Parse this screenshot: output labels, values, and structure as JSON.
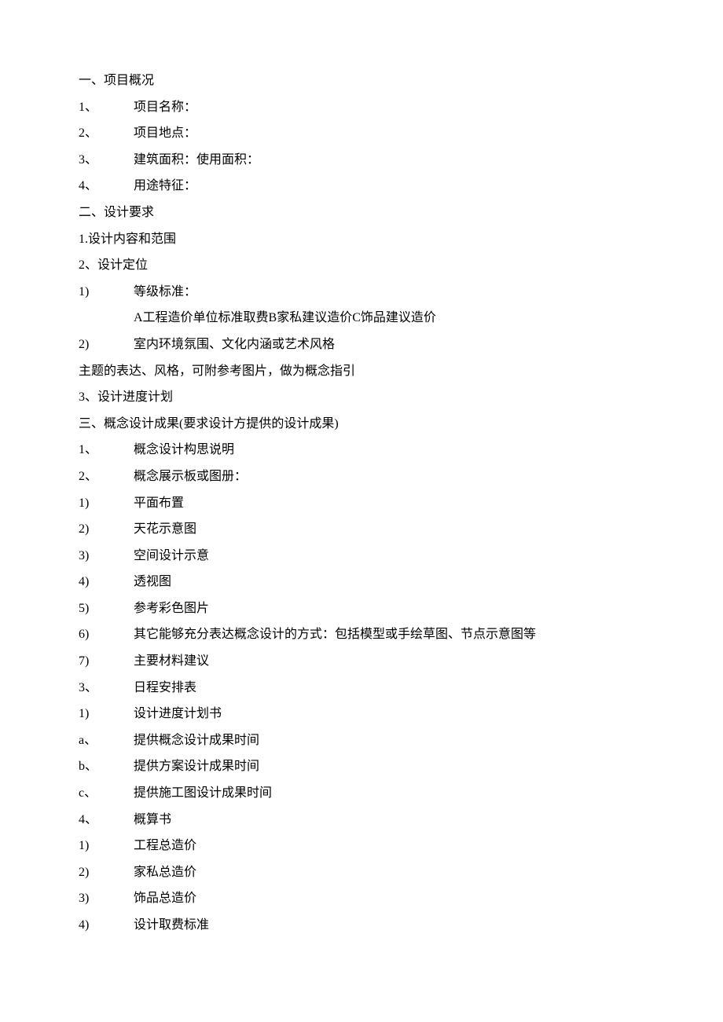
{
  "lines": [
    {
      "prefix": "",
      "bullet": "",
      "text": "一、项目概况"
    },
    {
      "prefix": "",
      "bullet": "1、",
      "text": "项目名称："
    },
    {
      "prefix": "",
      "bullet": "2、",
      "text": "项目地点："
    },
    {
      "prefix": "",
      "bullet": "3、",
      "text": "建筑面积：使用面积："
    },
    {
      "prefix": "",
      "bullet": "4、",
      "text": "用途特征："
    },
    {
      "prefix": "",
      "bullet": "",
      "text": "二、设计要求"
    },
    {
      "prefix": "",
      "bullet": "",
      "text": "1.设计内容和范围"
    },
    {
      "prefix": "",
      "bullet": "",
      "text": "2、设计定位"
    },
    {
      "prefix": "",
      "bullet": "1)",
      "text": "等级标准："
    },
    {
      "prefix": "",
      "bullet": "",
      "text": "A工程造价单位标准取费B家私建议造价C饰品建议造价",
      "extraIndent": true
    },
    {
      "prefix": "",
      "bullet": "2)",
      "text": "室内环境氛围、文化内涵或艺术风格"
    },
    {
      "prefix": "",
      "bullet": "",
      "text": "主题的表达、风格，可附参考图片，做为概念指引"
    },
    {
      "prefix": "",
      "bullet": "",
      "text": "3、设计进度计划"
    },
    {
      "prefix": "",
      "bullet": "",
      "text": "三、概念设计成果(要求设计方提供的设计成果)"
    },
    {
      "prefix": "",
      "bullet": "1、",
      "text": "概念设计构思说明"
    },
    {
      "prefix": "",
      "bullet": "2、",
      "text": "概念展示板或图册："
    },
    {
      "prefix": "",
      "bullet": "1)",
      "text": "平面布置"
    },
    {
      "prefix": "",
      "bullet": "2)",
      "text": "天花示意图"
    },
    {
      "prefix": "",
      "bullet": "3)",
      "text": "空间设计示意"
    },
    {
      "prefix": "",
      "bullet": "4)",
      "text": "透视图"
    },
    {
      "prefix": "",
      "bullet": "5)",
      "text": "参考彩色图片"
    },
    {
      "prefix": "",
      "bullet": "6)",
      "text": "其它能够充分表达概念设计的方式：包括模型或手绘草图、节点示意图等"
    },
    {
      "prefix": "",
      "bullet": "7)",
      "text": "主要材料建议"
    },
    {
      "prefix": "",
      "bullet": "3、",
      "text": "日程安排表"
    },
    {
      "prefix": "",
      "bullet": "1)",
      "text": "设计进度计划书"
    },
    {
      "prefix": "",
      "bullet": "a、",
      "text": "提供概念设计成果时间"
    },
    {
      "prefix": "",
      "bullet": "b、",
      "text": "提供方案设计成果时间"
    },
    {
      "prefix": "",
      "bullet": "c、",
      "text": "提供施工图设计成果时间"
    },
    {
      "prefix": "",
      "bullet": "4、",
      "text": "概算书"
    },
    {
      "prefix": "",
      "bullet": "1)",
      "text": "工程总造价"
    },
    {
      "prefix": "",
      "bullet": "2)",
      "text": "家私总造价"
    },
    {
      "prefix": "",
      "bullet": "3)",
      "text": "饰品总造价"
    },
    {
      "prefix": "",
      "bullet": "4)",
      "text": "设计取费标准"
    }
  ]
}
